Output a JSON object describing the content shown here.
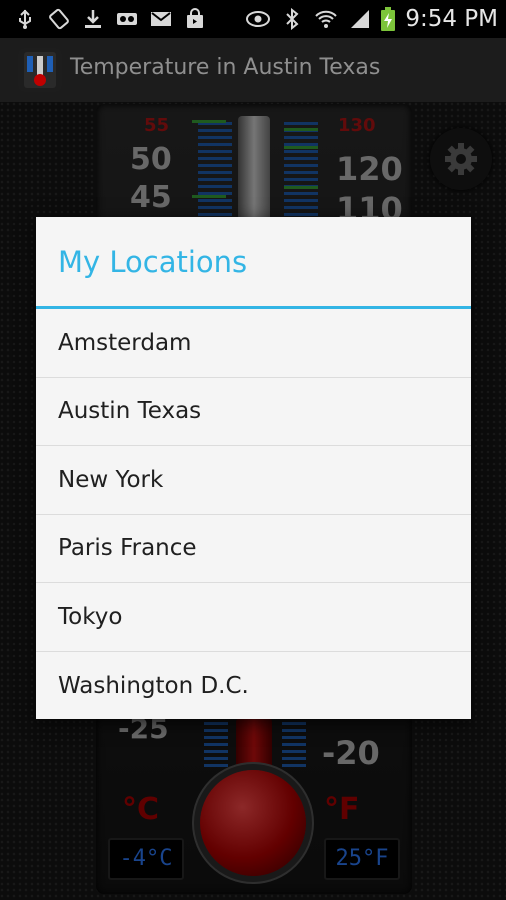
{
  "status_bar": {
    "time": "9:54 PM",
    "icons": [
      "usb-icon",
      "rotation-lock-icon",
      "download-icon",
      "voicemail-icon",
      "gmail-icon",
      "store-bag-icon",
      "eye-icon",
      "bluetooth-icon",
      "wifi-icon",
      "signal-icon",
      "battery-charging-icon"
    ]
  },
  "action_bar": {
    "title": "Temperature in Austin Texas"
  },
  "thermometer": {
    "celsius_labels": [
      "55",
      "50",
      "45",
      "-25"
    ],
    "fahrenheit_labels": [
      "130",
      "120",
      "110",
      "-20"
    ],
    "celsius_unit": "°C",
    "fahrenheit_unit": "°F",
    "celsius_reading": "-4°C",
    "fahrenheit_reading": "25°F",
    "bulb_color": "#c00000",
    "scale_color": "#1f5fb5"
  },
  "dialog": {
    "title": "My Locations",
    "accent_color": "#33b5e5",
    "items": [
      {
        "label": "Amsterdam"
      },
      {
        "label": "Austin Texas"
      },
      {
        "label": "New York"
      },
      {
        "label": "Paris France"
      },
      {
        "label": "Tokyo"
      },
      {
        "label": "Washington D.C."
      }
    ]
  }
}
